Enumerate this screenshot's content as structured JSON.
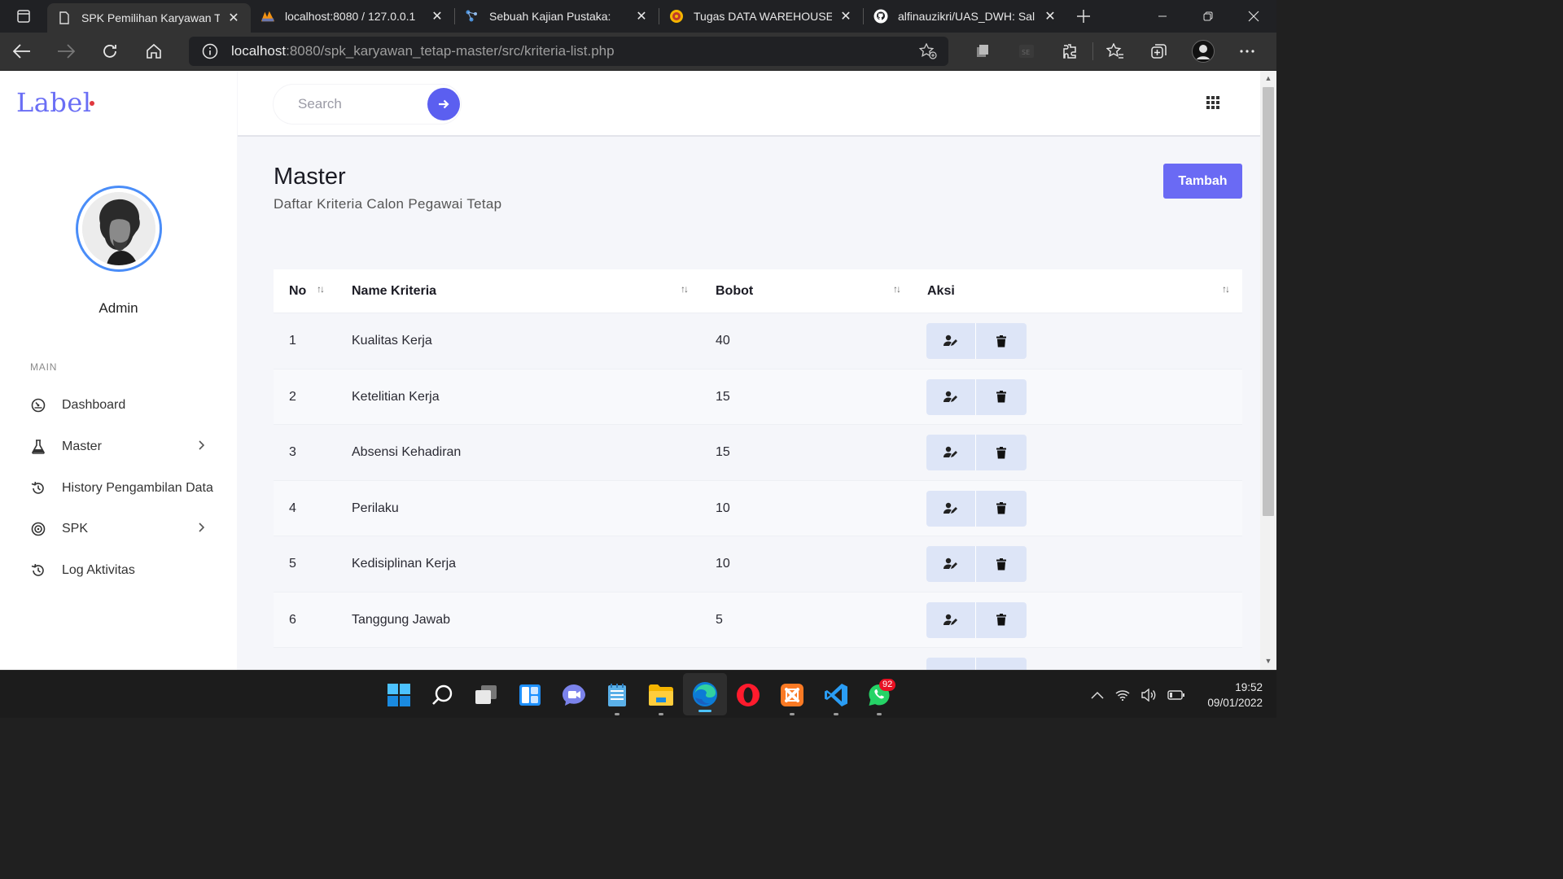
{
  "browser": {
    "tabs": [
      {
        "title": "SPK Pemilihan Karyawan T",
        "active": true,
        "favicon": "page-icon"
      },
      {
        "title": "localhost:8080 / 127.0.0.1",
        "active": false,
        "favicon": "phpmyadmin-icon"
      },
      {
        "title": "Sebuah Kajian Pustaka:",
        "active": false,
        "favicon": "scatter-icon"
      },
      {
        "title": "Tugas DATA WAREHOUSE",
        "active": false,
        "favicon": "university-icon"
      },
      {
        "title": "alfinauzikri/UAS_DWH: Sal",
        "active": false,
        "favicon": "github-icon"
      }
    ],
    "url_host": "localhost",
    "url_rest": ":8080/spk_karyawan_tetap-master/src/kriteria-list.php"
  },
  "sidebar": {
    "brand": "Label",
    "username": "Admin",
    "section_label": "MAIN",
    "items": [
      {
        "label": "Dashboard",
        "icon": "dashboard-icon",
        "has_children": false
      },
      {
        "label": "Master",
        "icon": "flask-icon",
        "has_children": true
      },
      {
        "label": "History Pengambilan Data",
        "icon": "history-icon",
        "has_children": false
      },
      {
        "label": "SPK",
        "icon": "target-icon",
        "has_children": true
      },
      {
        "label": "Log Aktivitas",
        "icon": "history-icon",
        "has_children": false
      }
    ]
  },
  "topnav": {
    "search_placeholder": "Search"
  },
  "main": {
    "title": "Master",
    "subtitle": "Daftar Kriteria Calon Pegawai Tetap",
    "add_button": "Tambah",
    "table": {
      "headers": {
        "no": "No",
        "name": "Name Kriteria",
        "bobot": "Bobot",
        "aksi": "Aksi"
      },
      "rows": [
        {
          "no": "1",
          "name": "Kualitas Kerja",
          "bobot": "40"
        },
        {
          "no": "2",
          "name": "Ketelitian Kerja",
          "bobot": "15"
        },
        {
          "no": "3",
          "name": "Absensi Kehadiran",
          "bobot": "15"
        },
        {
          "no": "4",
          "name": "Perilaku",
          "bobot": "10"
        },
        {
          "no": "5",
          "name": "Kedisiplinan Kerja",
          "bobot": "10"
        },
        {
          "no": "6",
          "name": "Tanggung Jawab",
          "bobot": "5"
        }
      ]
    }
  },
  "taskbar": {
    "time": "19:52",
    "date": "09/01/2022",
    "whatsapp_badge": "92"
  },
  "colors": {
    "accent": "#6a6af4",
    "brand": "#6a6ef5",
    "action_bg": "#dde5f7"
  }
}
